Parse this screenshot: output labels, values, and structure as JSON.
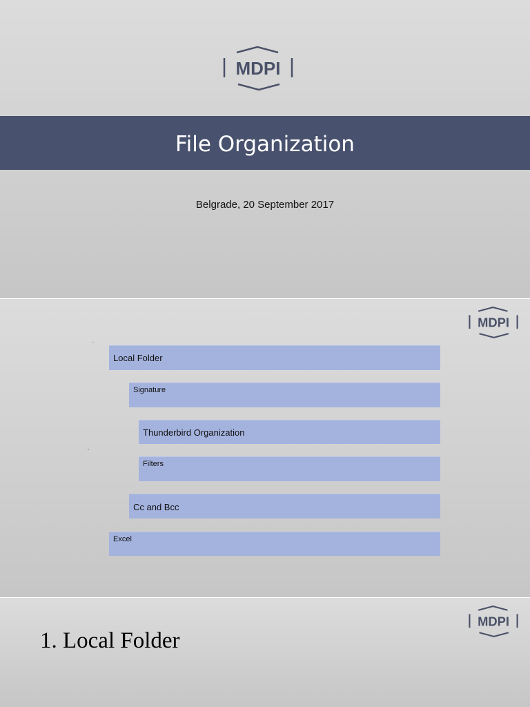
{
  "slides": [
    {
      "logo_text": "MDPI",
      "title": "File Organization",
      "subtitle": "Belgrade, 20 September 2017"
    },
    {
      "logo_text": "MDPI",
      "items": [
        {
          "label": "Local Folder"
        },
        {
          "label": "Signature"
        },
        {
          "label": "Thunderbird Organization"
        },
        {
          "label": "Filters"
        },
        {
          "label": "Cc and Bcc"
        },
        {
          "label": "Excel"
        }
      ],
      "box_color": "#a4b3de"
    },
    {
      "logo_text": "MDPI",
      "heading": "1. Local Folder"
    }
  ],
  "colors": {
    "title_band": "#48516d",
    "logo": "#4a5168"
  }
}
